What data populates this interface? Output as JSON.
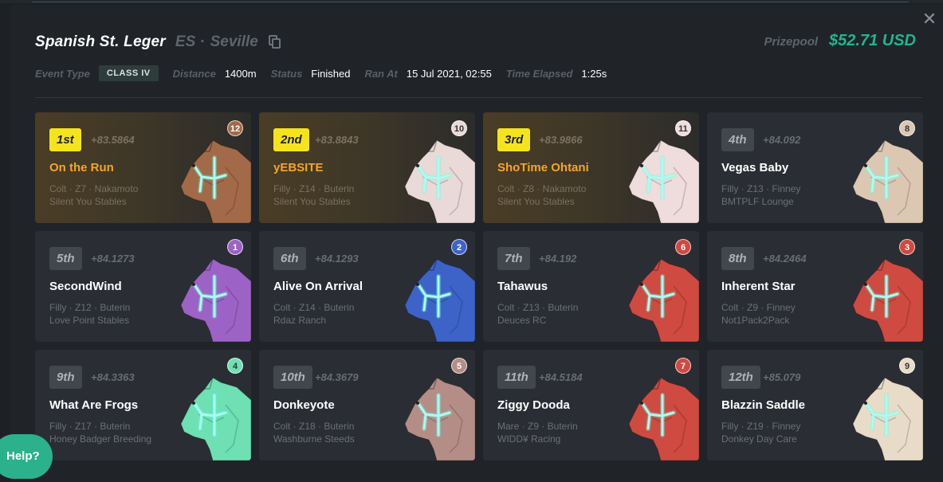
{
  "event": {
    "title": "Spanish St. Leger",
    "country": "ES",
    "separator": "·",
    "track": "Seville",
    "prize_label": "Prizepool",
    "prize_value": "$52.71 USD",
    "meta": {
      "event_type_label": "Event Type",
      "event_type_value": "CLASS IV",
      "distance_label": "Distance",
      "distance_value": "1400m",
      "status_label": "Status",
      "status_value": "Finished",
      "ran_at_label": "Ran At",
      "ran_at_value": "15 Jul 2021, 02:55",
      "elapsed_label": "Time Elapsed",
      "elapsed_value": "1:25s"
    }
  },
  "colors": {
    "accent": "#21b58f",
    "position_highlight": "#f4e41c",
    "top_name": "#f5a623"
  },
  "results": [
    {
      "pos": "1st",
      "time": "+83.5864",
      "name": "On the Run",
      "info": "Colt · Z7 · Nakamoto",
      "stable": "Silent You Stables",
      "gate": "12",
      "color": "#a26a48",
      "top": true
    },
    {
      "pos": "2nd",
      "time": "+83.8843",
      "name": "yEBSITE",
      "info": "Filly · Z14 · Buterin",
      "stable": "Silent You Stables",
      "gate": "10",
      "color": "#e9d9d7",
      "top": true
    },
    {
      "pos": "3rd",
      "time": "+83.9866",
      "name": "ShoTime Ohtani",
      "info": "Colt · Z8 · Nakamoto",
      "stable": "Silent You Stables",
      "gate": "11",
      "color": "#efdcdc",
      "top": true
    },
    {
      "pos": "4th",
      "time": "+84.092",
      "name": "Vegas Baby",
      "info": "Filly · Z13 · Finney",
      "stable": "BMTPLF Lounge",
      "gate": "8",
      "color": "#dcc7b3",
      "top": false
    },
    {
      "pos": "5th",
      "time": "+84.1273",
      "name": "SecondWind",
      "info": "Filly · Z12 · Buterin",
      "stable": "Love Point Stables",
      "gate": "1",
      "color": "#9d62c6",
      "top": false
    },
    {
      "pos": "6th",
      "time": "+84.1293",
      "name": "Alive On Arrival",
      "info": "Colt · Z14 · Buterin",
      "stable": "Rdaz Ranch",
      "gate": "2",
      "color": "#3d63c9",
      "top": false
    },
    {
      "pos": "7th",
      "time": "+84.192",
      "name": "Tahawus",
      "info": "Colt · Z13 · Buterin",
      "stable": "Deuces RC",
      "gate": "6",
      "color": "#cf4a40",
      "top": false
    },
    {
      "pos": "8th",
      "time": "+84.2464",
      "name": "Inherent Star",
      "info": "Colt · Z9 · Finney",
      "stable": "Not1Pack2Pack",
      "gate": "3",
      "color": "#cf4a40",
      "top": false
    },
    {
      "pos": "9th",
      "time": "+84.3363",
      "name": "What Are Frogs",
      "info": "Filly · Z17 · Buterin",
      "stable": "Honey Badger Breeding",
      "gate": "4",
      "color": "#6ee0b3",
      "top": false
    },
    {
      "pos": "10th",
      "time": "+84.3679",
      "name": "Donkeyote",
      "info": "Colt · Z18 · Buterin",
      "stable": "Washburne Steeds",
      "gate": "5",
      "color": "#b58d87",
      "top": false
    },
    {
      "pos": "11th",
      "time": "+84.5184",
      "name": "Ziggy Dooda",
      "info": "Mare · Z9 · Buterin",
      "stable": "WIDD¥ Racing",
      "gate": "7",
      "color": "#cf4a40",
      "top": false
    },
    {
      "pos": "12th",
      "time": "+85.079",
      "name": "Blazzin Saddle",
      "info": "Filly · Z19 · Finney",
      "stable": "Donkey Day Care",
      "gate": "9",
      "color": "#e8dcc9",
      "top": false
    }
  ],
  "help_label": "Help?",
  "close_glyph": "✕"
}
